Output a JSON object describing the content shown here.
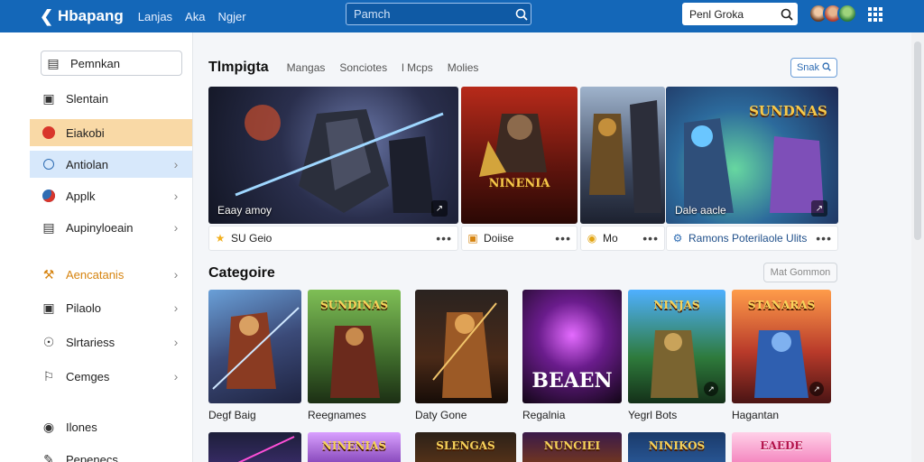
{
  "header": {
    "brand": "Hbapang",
    "nav": [
      "Lanjas",
      "Aka",
      "Ngjer"
    ],
    "search_placeholder": "Pamch",
    "user_search": "Penl Groka"
  },
  "sidebar": {
    "items": [
      {
        "label": "Pemnkan",
        "icon": "menu-box-icon"
      },
      {
        "label": "Slentain",
        "icon": "image-icon"
      },
      {
        "label": "Eiakobi",
        "icon": "game-icon"
      },
      {
        "label": "Antiolan",
        "icon": "circle-icon"
      },
      {
        "label": "Applk",
        "icon": "globe-icon"
      },
      {
        "label": "Aupinyloeain",
        "icon": "window-icon"
      },
      {
        "label": "Aencatanis",
        "icon": "hammer-icon"
      },
      {
        "label": "Pilaolo",
        "icon": "picture-icon"
      },
      {
        "label": "Slrtariess",
        "icon": "radio-icon"
      },
      {
        "label": "Cemges",
        "icon": "flag-icon"
      },
      {
        "label": "Ilones",
        "icon": "controller-icon"
      },
      {
        "label": "Pepenecs",
        "icon": "pen-icon"
      }
    ]
  },
  "main": {
    "tabs": [
      "Tlmpigta",
      "Mangas",
      "Sonciotes",
      "l Mcps",
      "Molies"
    ],
    "search_chip": "Snak",
    "features": [
      {
        "caption": "Eaay amoy",
        "title": "",
        "info": "SU Geio"
      },
      {
        "caption": "",
        "title": "NINENIA",
        "info": "Doiise"
      },
      {
        "caption": "",
        "title": "",
        "info": "Mo"
      },
      {
        "caption": "Dale aacle",
        "title": "SUNDNAS",
        "info": "Ramons Poterilaole Ulits"
      }
    ],
    "section_title": "Categoire",
    "more_button": "Mat Gommon",
    "categories": [
      {
        "label": "Degf Baig",
        "title": "",
        "big": ""
      },
      {
        "label": "Reegnames",
        "title": "SUNDINAS",
        "big": ""
      },
      {
        "label": "Daty Gone",
        "title": "",
        "big": ""
      },
      {
        "label": "Regalnia",
        "title": "",
        "big": "BEAEN"
      },
      {
        "label": "Yegrl Bots",
        "title": "NINJAS",
        "big": ""
      },
      {
        "label": "Hagantan",
        "title": "STANARAS",
        "big": ""
      }
    ],
    "row3": [
      "",
      "NINENIAS",
      "SLENGAS",
      "NUNCIEI",
      "NINIKOS",
      "EAEDE"
    ]
  },
  "colors": {
    "topbar": "#1467b8",
    "highlight_orange": "#f9d9a6",
    "highlight_blue": "#d7e8fb"
  }
}
